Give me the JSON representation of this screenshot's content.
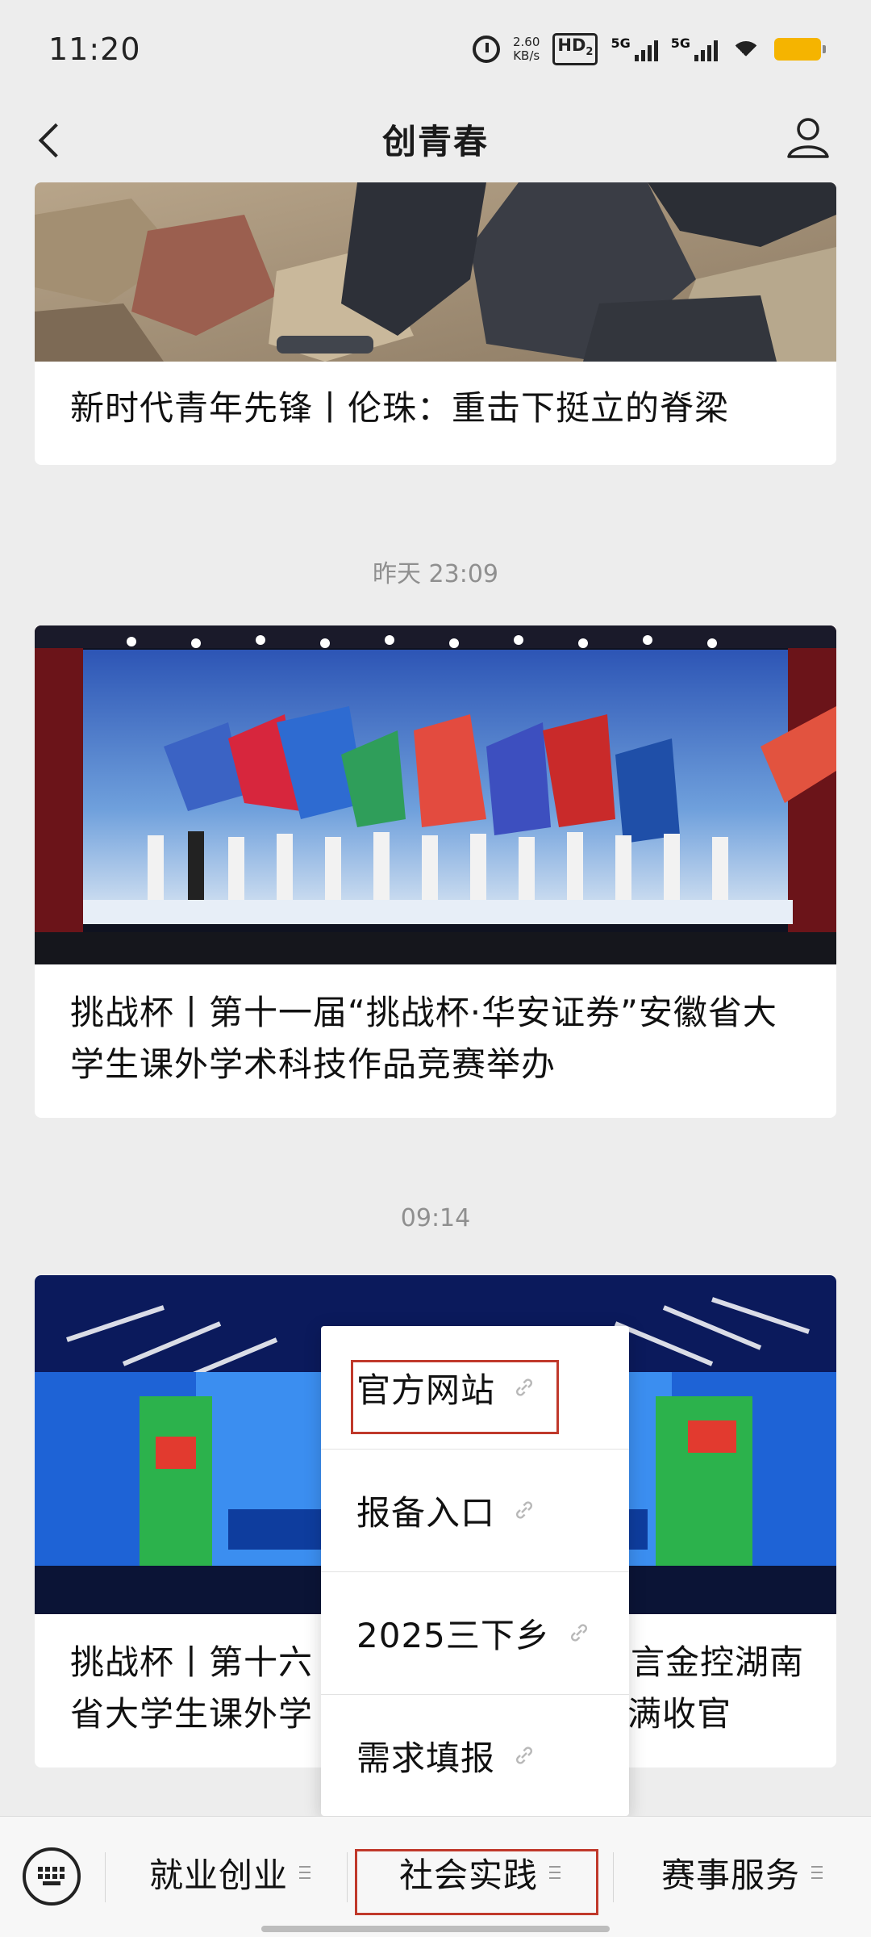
{
  "status_bar": {
    "time": "11:20",
    "net_speed_value": "2.60",
    "net_speed_unit": "KB/s",
    "hd_label": "HD",
    "hd_sub": "2",
    "signal_1": "5G",
    "signal_2": "5G",
    "battery_color": "#f5b400"
  },
  "header": {
    "title": "创青春",
    "back_icon": "chevron-left-icon",
    "profile_icon": "user-icon"
  },
  "feed": {
    "articles": [
      {
        "title": "新时代青年先锋丨伦珠：重击下挺立的脊梁"
      },
      {
        "timestamp": "昨天 23:09",
        "title": "挑战杯丨第十一届“挑战杯·华安证券”安徽省大学生课外学术科技作品竞赛举办"
      },
      {
        "timestamp": "09:14",
        "title_left": "挑战杯丨第十六",
        "title_right": "言金控湖南",
        "title_left_2": "省大学生课外学",
        "title_right_2": "满收官"
      }
    ]
  },
  "popup_menu": {
    "items": [
      {
        "label": "官方网站",
        "icon": "link-icon"
      },
      {
        "label": "报备入口",
        "icon": "link-icon"
      },
      {
        "label": "2025三下乡",
        "icon": "link-icon"
      },
      {
        "label": "需求填报",
        "icon": "link-icon"
      }
    ],
    "highlight_color": "#c0392b"
  },
  "bottom_bar": {
    "keyboard_icon": "keyboard-icon",
    "tabs": [
      {
        "label": "就业创业"
      },
      {
        "label": "社会实践"
      },
      {
        "label": "赛事服务"
      }
    ]
  }
}
